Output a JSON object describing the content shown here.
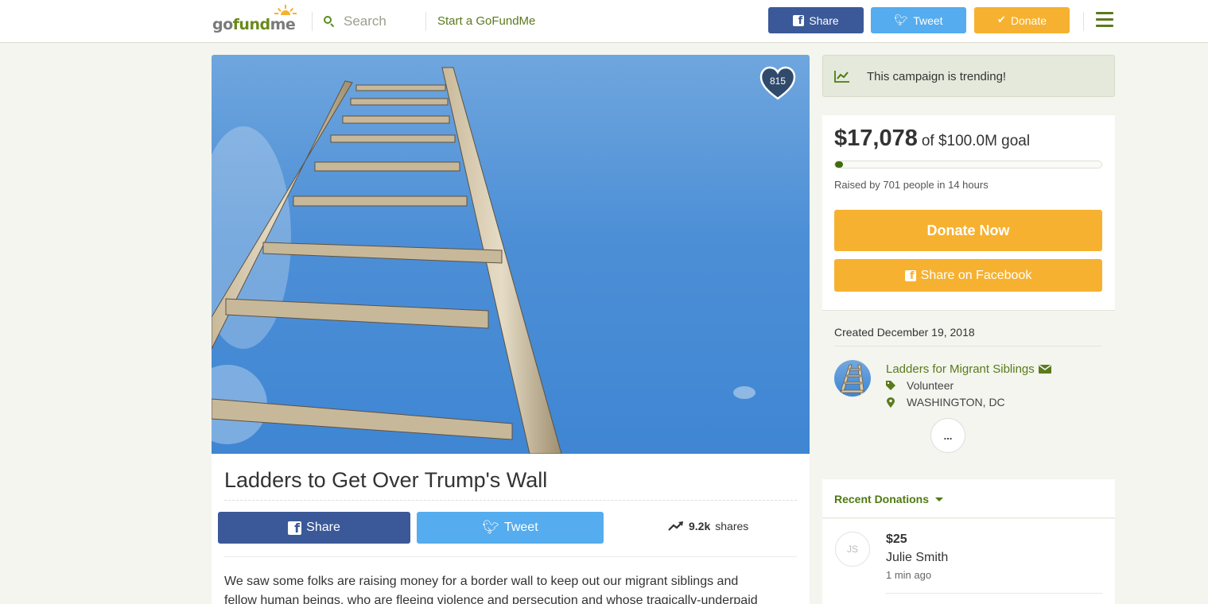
{
  "header": {
    "logo": {
      "part1": "go",
      "part2": "fund",
      "part3": "me"
    },
    "search_placeholder": "Search",
    "start_link": "Start a GoFundMe",
    "share_label": "Share",
    "tweet_label": "Tweet",
    "donate_label": "Donate"
  },
  "hero": {
    "hearts": "815"
  },
  "campaign": {
    "title": "Ladders to Get Over Trump's Wall",
    "share_label": "Share",
    "tweet_label": "Tweet",
    "shares_count": "9.2k",
    "shares_label": "shares",
    "story": "We saw some folks are raising money for a border wall to keep out our migrant siblings and fellow human beings, who are fleeing violence and persecution and whose tragically-underpaid labor is"
  },
  "sidebar": {
    "trending": "This campaign is trending!",
    "raised_amount": "$17,078",
    "goal_text": "of $100.0M goal",
    "progress_fraction": 0.00017,
    "raised_by": "Raised by 701 people in 14 hours",
    "donate_now": "Donate Now",
    "share_facebook": "Share on Facebook",
    "created": "Created December 19, 2018",
    "organizer_name": "Ladders for Migrant Siblings",
    "organizer_category": "Volunteer",
    "organizer_location": "WASHINGTON, DC",
    "more_label": "...",
    "recent_donations_label": "Recent Donations",
    "donations": [
      {
        "initials": "JS",
        "amount": "$25",
        "name": "Julie Smith",
        "time": "1 min ago"
      }
    ]
  },
  "colors": {
    "brand_green": "#5a7a1c",
    "facebook": "#3b5998",
    "twitter": "#55acee",
    "donate_orange": "#f6b130",
    "page_bg": "#f3f5ee"
  },
  "icons": [
    "search-icon",
    "menu-icon",
    "facebook-icon",
    "twitter-icon",
    "check-icon",
    "heart-icon",
    "trending-icon",
    "envelope-icon",
    "tag-icon",
    "map-pin-icon",
    "caret-down-icon"
  ]
}
